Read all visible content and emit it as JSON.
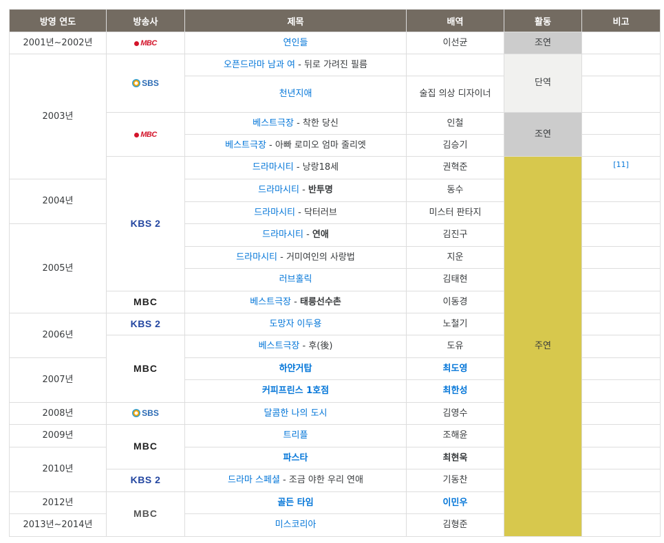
{
  "headers": {
    "year": "방영 연도",
    "network": "방송사",
    "title": "제목",
    "role": "배역",
    "activity": "활동",
    "note": "비고"
  },
  "networks": {
    "mbc_old": "MBC",
    "sbs": "SBS",
    "kbs2": "KBS 2",
    "mbc": "MBC"
  },
  "years": {
    "y2001": "2001년~2002년",
    "y2003": "2003년",
    "y2004": "2004년",
    "y2005": "2005년",
    "y2006": "2006년",
    "y2007": "2007년",
    "y2008": "2008년",
    "y2009": "2009년",
    "y2010": "2010년",
    "y2012": "2012년",
    "y2013": "2013년~2014년"
  },
  "activities": {
    "support1": "조연",
    "cameo": "단역",
    "support2": "조연",
    "lead": "주연"
  },
  "rows": [
    {
      "link": "연인들",
      "rest": "",
      "role": "이선균"
    },
    {
      "link": "오픈드라마 남과 여",
      "rest": " - 뒤로 가려진 필름",
      "role": ""
    },
    {
      "link": "천년지애",
      "rest": "",
      "role": "술집 의상 디자이너"
    },
    {
      "link": "베스트극장",
      "rest": " - 착한 당신",
      "role": "인철"
    },
    {
      "link": "베스트극장",
      "rest": " - 아빠 로미오 엄마 줄리엣",
      "role": "김승기"
    },
    {
      "link": "드라마시티",
      "rest": " - 낭랑18세",
      "role": "권혁준",
      "note": "[11]"
    },
    {
      "link": "드라마시티",
      "rest": "반투명",
      "role": "동수"
    },
    {
      "link": "드라마시티",
      "rest": " - 닥터러브",
      "role": "미스터 판타지"
    },
    {
      "link": "드라마시티",
      "rest": "연애",
      "role": "김진구"
    },
    {
      "link": "드라마시티",
      "rest": " - 거미여인의 사랑법",
      "role": "지운"
    },
    {
      "link": "러브홀릭",
      "rest": "",
      "role": "김태현"
    },
    {
      "link": "베스트극장",
      "rest": "태릉선수촌",
      "role": "이동경"
    },
    {
      "link": "도망자 이두용",
      "rest": "",
      "role": "노철기"
    },
    {
      "link": "베스트극장",
      "rest": " - 후(後)",
      "role": "도유"
    },
    {
      "link": "하얀거탑",
      "rest": "",
      "role": "최도영"
    },
    {
      "link": "커피프린스 1호점",
      "rest": "",
      "role": "최한성"
    },
    {
      "link": "달콤한 나의 도시",
      "rest": "",
      "role": "김영수"
    },
    {
      "link": "트리플",
      "rest": "",
      "role": "조해윤"
    },
    {
      "link": "파스타",
      "rest": "",
      "role": "최현욱"
    },
    {
      "link": "드라마 스페셜",
      "rest": " - 조금 야한 우리 연애",
      "role": "기동찬"
    },
    {
      "link": "골든 타임",
      "rest": "",
      "role": "이민우"
    },
    {
      "link": "미스코리아",
      "rest": "",
      "role": "김형준"
    }
  ],
  "sep": " - "
}
